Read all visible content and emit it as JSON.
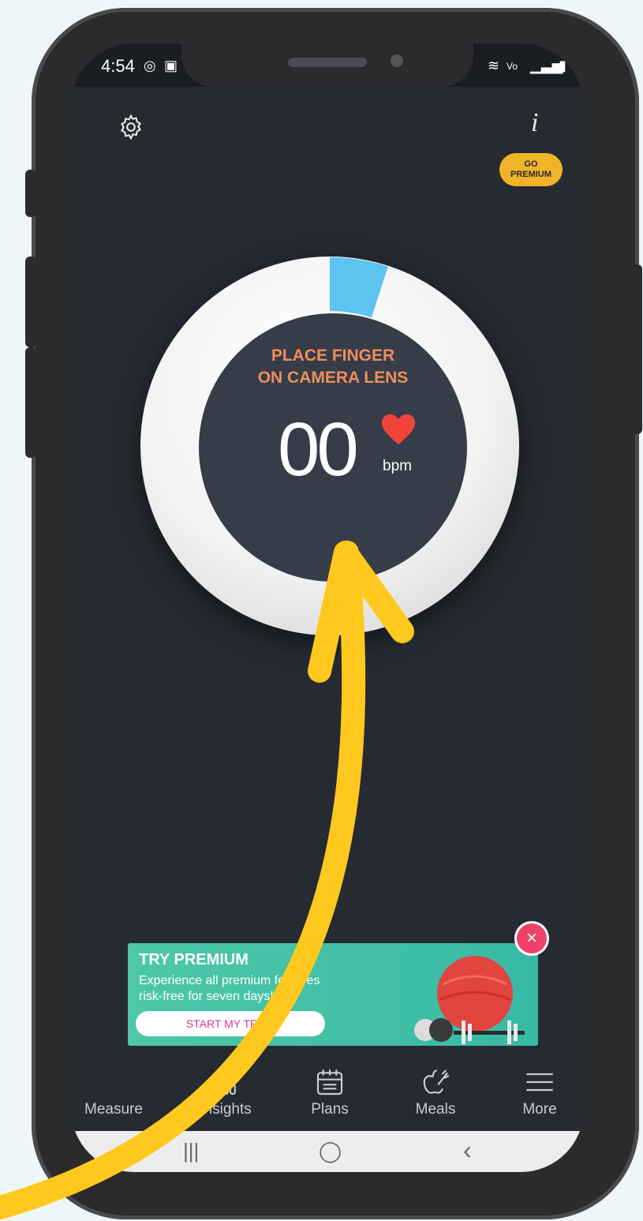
{
  "status_bar": {
    "time": "4:54"
  },
  "header": {
    "settings_icon": "gear-icon",
    "info_label": "i",
    "premium_line1": "GO",
    "premium_line2": "PREMIUM"
  },
  "measure": {
    "instruction_line1": "PLACE FINGER",
    "instruction_line2": "ON CAMERA LENS",
    "bpm_value": "00",
    "bpm_unit": "bpm",
    "progress_fraction": 0.05,
    "colors": {
      "progress": "#5bc4ef",
      "heart": "#f0443a",
      "instruction": "#f08e5a"
    }
  },
  "promo": {
    "title": "TRY PREMIUM",
    "line1": "Experience all premium features",
    "line2": "risk-free for seven days!",
    "cta": "START MY TRIAL",
    "close_label": "×"
  },
  "nav": {
    "items": [
      {
        "label": "Measure",
        "icon": "heart-rate-icon"
      },
      {
        "label": "Insights",
        "icon": "bar-chart-icon"
      },
      {
        "label": "Plans",
        "icon": "calendar-icon"
      },
      {
        "label": "Meals",
        "icon": "apple-carrot-icon"
      },
      {
        "label": "More",
        "icon": "menu-icon"
      }
    ]
  },
  "system_nav": {
    "recents": "|||",
    "home": "◯",
    "back": "‹"
  }
}
